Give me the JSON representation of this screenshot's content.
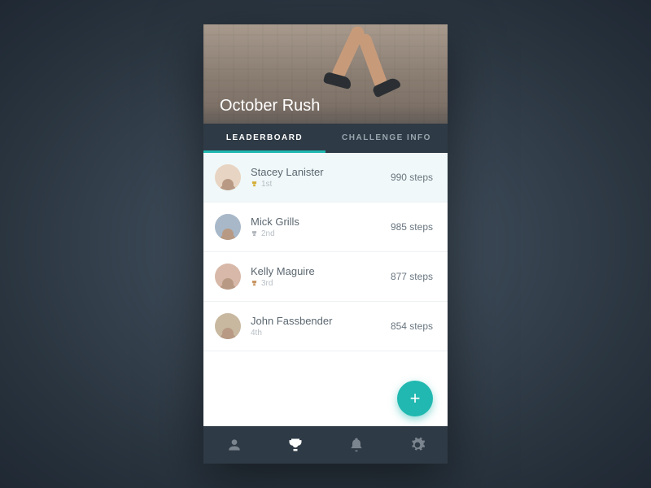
{
  "hero": {
    "title": "October Rush"
  },
  "tabs": {
    "leaderboard": "LEADERBOARD",
    "challenge_info": "CHALLENGE INFO",
    "active": "leaderboard"
  },
  "leaderboard": [
    {
      "name": "Stacey Lanister",
      "rank_label": "1st",
      "steps_label": "990 steps",
      "has_trophy": true
    },
    {
      "name": "Mick Grills",
      "rank_label": "2nd",
      "steps_label": "985 steps",
      "has_trophy": true
    },
    {
      "name": "Kelly Maguire",
      "rank_label": "3rd",
      "steps_label": "877 steps",
      "has_trophy": true
    },
    {
      "name": "John Fassbender",
      "rank_label": "4th",
      "steps_label": "854 steps",
      "has_trophy": false
    }
  ],
  "fab": {
    "label": "+"
  },
  "nav": {
    "items": [
      "profile",
      "trophy",
      "bell",
      "gear"
    ],
    "active": "trophy"
  },
  "colors": {
    "accent": "#20b8b0",
    "tab_bg": "#2e3a45"
  }
}
